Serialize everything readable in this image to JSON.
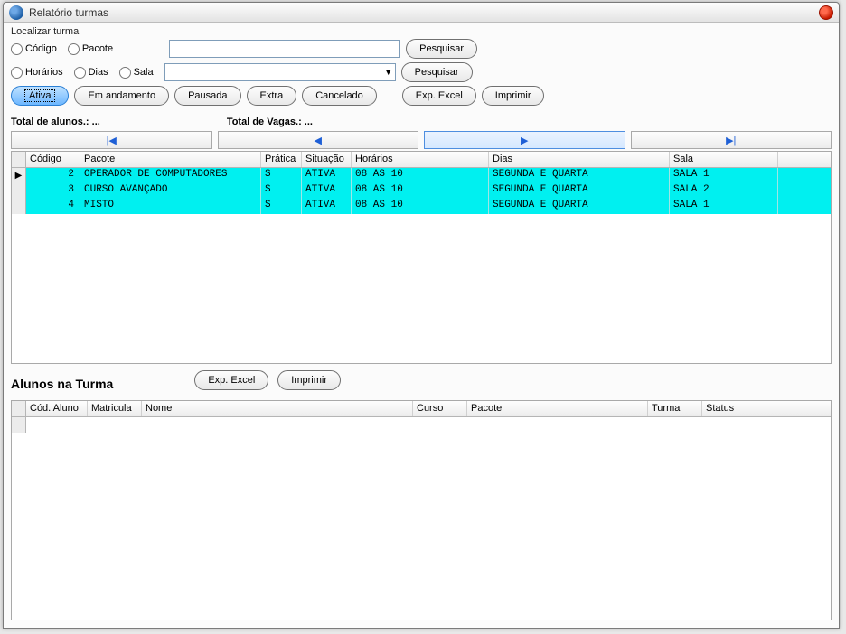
{
  "window": {
    "title": "Relatório turmas"
  },
  "search": {
    "legend": "Localizar turma",
    "radio1": {
      "codigo": "Código",
      "pacote": "Pacote"
    },
    "radio2": {
      "horarios": "Horários",
      "dias": "Dias",
      "sala": "Sala"
    },
    "pesquisar": "Pesquisar"
  },
  "filters": {
    "ativa": "Ativa",
    "em_andamento": "Em andamento",
    "pausada": "Pausada",
    "extra": "Extra",
    "cancelado": "Cancelado",
    "exp_excel": "Exp. Excel",
    "imprimir": "Imprimir"
  },
  "totals": {
    "alunos": "Total de alunos.: ...",
    "vagas": "Total de Vagas.: ..."
  },
  "nav": {
    "first": "|◀",
    "prev": "◀",
    "next": "▶",
    "last": "▶|"
  },
  "grid1": {
    "headers": {
      "codigo": "Código",
      "pacote": "Pacote",
      "pratica": "Prática",
      "situacao": "Situação",
      "horarios": "Horários",
      "dias": "Dias",
      "sala": "Sala"
    },
    "rows": [
      {
        "codigo": "2",
        "pacote": "OPERADOR DE COMPUTADORES",
        "pratica": "S",
        "situacao": "ATIVA",
        "horarios": "08 AS 10",
        "dias": "SEGUNDA E QUARTA",
        "sala": "SALA 1"
      },
      {
        "codigo": "3",
        "pacote": "CURSO AVANÇADO",
        "pratica": "S",
        "situacao": "ATIVA",
        "horarios": "08 AS 10",
        "dias": "SEGUNDA E QUARTA",
        "sala": "SALA 2"
      },
      {
        "codigo": "4",
        "pacote": "MISTO",
        "pratica": "S",
        "situacao": "ATIVA",
        "horarios": "08 AS 10",
        "dias": "SEGUNDA E QUARTA",
        "sala": "SALA 1"
      }
    ]
  },
  "section2": {
    "title": "Alunos na Turma",
    "exp_excel": "Exp. Excel",
    "imprimir": "Imprimir"
  },
  "grid2": {
    "headers": {
      "codaluno": "Cód. Aluno",
      "matricula": "Matricula",
      "nome": "Nome",
      "curso": "Curso",
      "pacote": "Pacote",
      "turma": "Turma",
      "status": "Status"
    }
  }
}
